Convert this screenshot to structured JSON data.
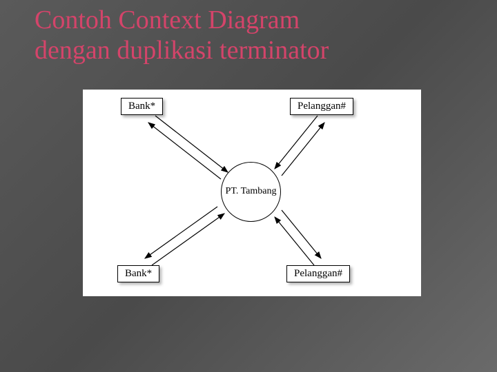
{
  "title_line1": "Contoh Context Diagram",
  "title_line2": "dengan duplikasi terminator",
  "diagram": {
    "process": "PT. Tambang",
    "terminators": {
      "top_left": "Bank*",
      "top_right": "Pelanggan#",
      "bottom_left": "Bank*",
      "bottom_right": "Pelanggan#"
    }
  }
}
